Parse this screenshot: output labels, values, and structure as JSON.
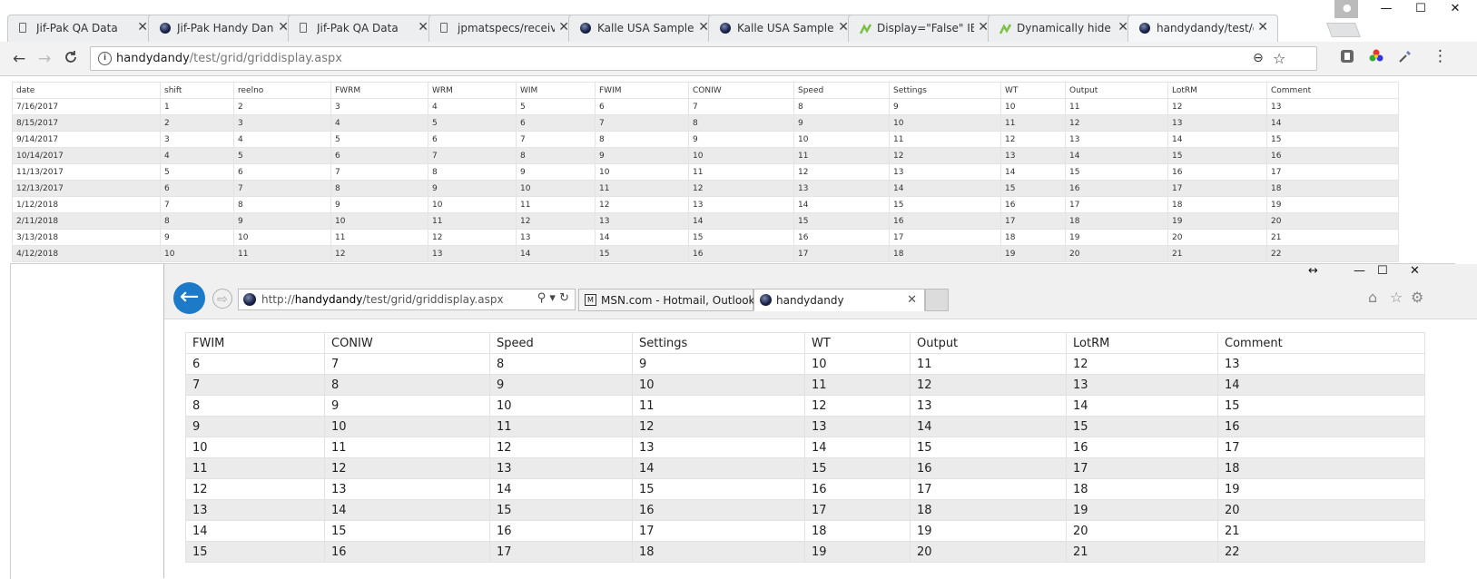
{
  "chrome": {
    "tabs": [
      {
        "title": "Jif-Pak QA Data",
        "icon": "document-icon"
      },
      {
        "title": "Jif-Pak Handy Dand",
        "icon": "globe-icon"
      },
      {
        "title": "Jif-Pak QA Data",
        "icon": "document-icon"
      },
      {
        "title": "jpmatspecs/receivi",
        "icon": "document-icon"
      },
      {
        "title": "Kalle USA Sample I",
        "icon": "globe-icon"
      },
      {
        "title": "Kalle USA Sample I",
        "icon": "globe-icon"
      },
      {
        "title": "Display=\"False\" IE",
        "icon": "leaf-icon"
      },
      {
        "title": "Dynamically hide G",
        "icon": "leaf-icon"
      },
      {
        "title": "handydandy/test/g",
        "icon": "globe-icon",
        "active": true
      }
    ],
    "close_glyph": "✕",
    "url_host": "handydandy",
    "url_path": "/test/grid/griddisplay.aspx",
    "nav": {
      "back": "←",
      "forward": "→",
      "reload": "C"
    },
    "window_controls": {
      "minimize": "—",
      "maximize": "☐",
      "close": "✕"
    },
    "right_icons": {
      "zoom": "⊖",
      "star": "☆",
      "menu": "⋮"
    }
  },
  "grid_small": {
    "columns": [
      "date",
      "shift",
      "reelno",
      "FWRM",
      "WRM",
      "WIM",
      "FWIM",
      "CONIW",
      "Speed",
      "Settings",
      "WT",
      "Output",
      "LotRM",
      "Comment"
    ],
    "rows": [
      [
        "7/16/2017",
        "1",
        "2",
        "3",
        "4",
        "5",
        "6",
        "7",
        "8",
        "9",
        "10",
        "11",
        "12",
        "13"
      ],
      [
        "8/15/2017",
        "2",
        "3",
        "4",
        "5",
        "6",
        "7",
        "8",
        "9",
        "10",
        "11",
        "12",
        "13",
        "14"
      ],
      [
        "9/14/2017",
        "3",
        "4",
        "5",
        "6",
        "7",
        "8",
        "9",
        "10",
        "11",
        "12",
        "13",
        "14",
        "15"
      ],
      [
        "10/14/2017",
        "4",
        "5",
        "6",
        "7",
        "8",
        "9",
        "10",
        "11",
        "12",
        "13",
        "14",
        "15",
        "16"
      ],
      [
        "11/13/2017",
        "5",
        "6",
        "7",
        "8",
        "9",
        "10",
        "11",
        "12",
        "13",
        "14",
        "15",
        "16",
        "17"
      ],
      [
        "12/13/2017",
        "6",
        "7",
        "8",
        "9",
        "10",
        "11",
        "12",
        "13",
        "14",
        "15",
        "16",
        "17",
        "18"
      ],
      [
        "1/12/2018",
        "7",
        "8",
        "9",
        "10",
        "11",
        "12",
        "13",
        "14",
        "15",
        "16",
        "17",
        "18",
        "19"
      ],
      [
        "2/11/2018",
        "8",
        "9",
        "10",
        "11",
        "12",
        "13",
        "14",
        "15",
        "16",
        "17",
        "18",
        "19",
        "20"
      ],
      [
        "3/13/2018",
        "9",
        "10",
        "11",
        "12",
        "13",
        "14",
        "15",
        "16",
        "17",
        "18",
        "19",
        "20",
        "21"
      ],
      [
        "4/12/2018",
        "10",
        "11",
        "12",
        "13",
        "14",
        "15",
        "16",
        "17",
        "18",
        "19",
        "20",
        "21",
        "22"
      ]
    ]
  },
  "ie": {
    "url_scheme": "http://",
    "url_host": "handydandy",
    "url_path": "/test/grid/griddisplay.aspx",
    "address_tools": "⚲ ▾ ↻",
    "back": "←",
    "forward": "⇨",
    "tabs": [
      {
        "title": "MSN.com - Hotmail, Outlook, ...",
        "icon": "msn-icon"
      },
      {
        "title": "handydandy",
        "icon": "globe-icon",
        "active": true
      }
    ],
    "tab_close": "✕",
    "window_controls": {
      "resize": "↔",
      "minimize": "—",
      "maximize": "☐",
      "close": "✕"
    },
    "right_icons": {
      "home": "⌂",
      "favorites": "☆",
      "settings": "⚙"
    }
  },
  "grid_large": {
    "columns": [
      "FWIM",
      "CONIW",
      "Speed",
      "Settings",
      "WT",
      "Output",
      "LotRM",
      "Comment"
    ],
    "rows": [
      [
        "6",
        "7",
        "8",
        "9",
        "10",
        "11",
        "12",
        "13"
      ],
      [
        "7",
        "8",
        "9",
        "10",
        "11",
        "12",
        "13",
        "14"
      ],
      [
        "8",
        "9",
        "10",
        "11",
        "12",
        "13",
        "14",
        "15"
      ],
      [
        "9",
        "10",
        "11",
        "12",
        "13",
        "14",
        "15",
        "16"
      ],
      [
        "10",
        "11",
        "12",
        "13",
        "14",
        "15",
        "16",
        "17"
      ],
      [
        "11",
        "12",
        "13",
        "14",
        "15",
        "16",
        "17",
        "18"
      ],
      [
        "12",
        "13",
        "14",
        "15",
        "16",
        "17",
        "18",
        "19"
      ],
      [
        "13",
        "14",
        "15",
        "16",
        "17",
        "18",
        "19",
        "20"
      ],
      [
        "14",
        "15",
        "16",
        "17",
        "18",
        "19",
        "20",
        "21"
      ],
      [
        "15",
        "16",
        "17",
        "18",
        "19",
        "20",
        "21",
        "22"
      ]
    ]
  }
}
